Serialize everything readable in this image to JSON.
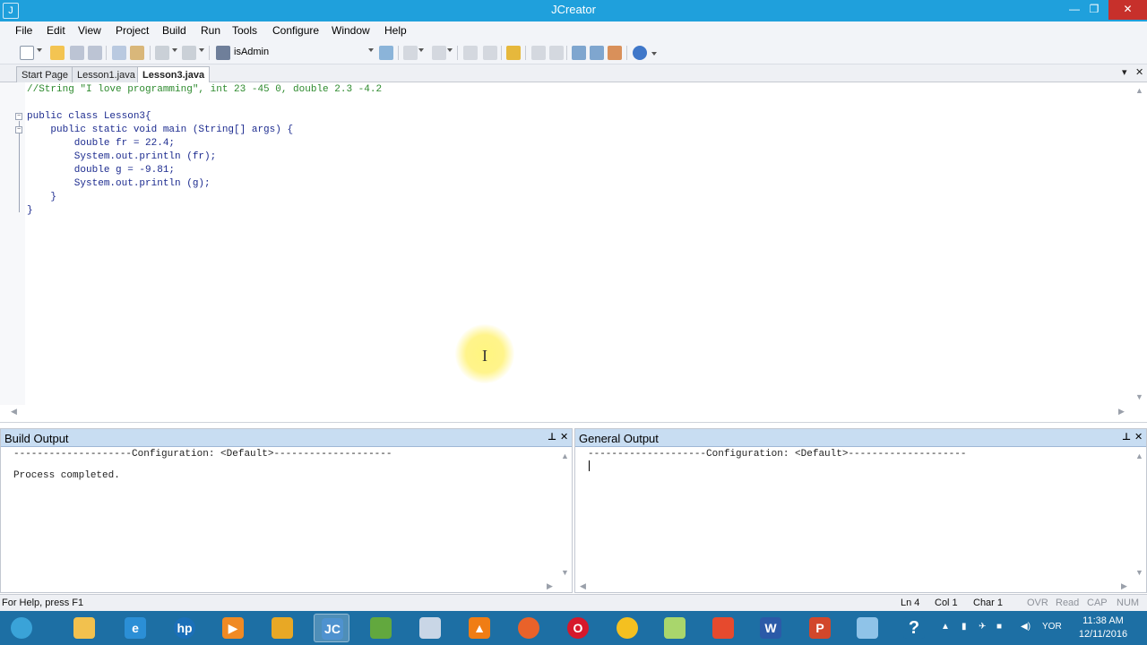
{
  "window": {
    "title": "JCreator"
  },
  "menu": [
    "File",
    "Edit",
    "View",
    "Project",
    "Build",
    "Run",
    "Tools",
    "Configure",
    "Window",
    "Help"
  ],
  "toolbar": {
    "project_combo": "isAdmin"
  },
  "tabs": [
    {
      "label": "Start Page",
      "active": false
    },
    {
      "label": "Lesson1.java",
      "active": false
    },
    {
      "label": "Lesson3.java",
      "active": true
    }
  ],
  "editor": {
    "lines": [
      "//String \"I love programming\", int 23 -45 0, double 2.3 -4.2",
      "",
      "public class Lesson3{",
      "    public static void main (String[] args) {",
      "        double fr = 22.4;",
      "        System.out.println (fr);",
      "        double g = -9.81;",
      "        System.out.println (g);",
      "    }",
      "}"
    ]
  },
  "build_output": {
    "title": "Build Output",
    "lines": [
      "--------------------Configuration: <Default>--------------------",
      "",
      "Process completed."
    ]
  },
  "general_output": {
    "title": "General Output",
    "lines": [
      "--------------------Configuration: <Default>--------------------"
    ]
  },
  "status": {
    "help": "For Help, press F1",
    "ln": "Ln 4",
    "col": "Col 1",
    "char": "Char 1",
    "ovr": "OVR",
    "read": "Read",
    "cap": "CAP",
    "num": "NUM"
  },
  "taskbar": {
    "lang": "YOR",
    "time": "11:38 AM",
    "date": "12/11/2016"
  }
}
